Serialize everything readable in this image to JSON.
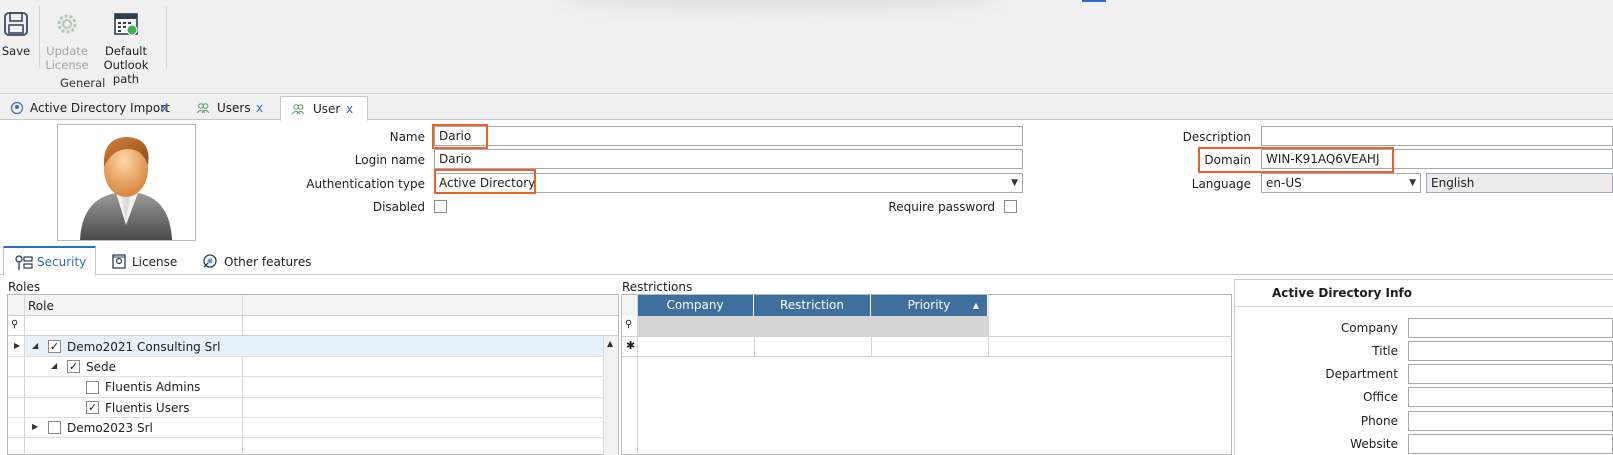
{
  "ribbon": {
    "buttons": [
      {
        "label": "Save",
        "icon": "save-icon",
        "enabled": true
      },
      {
        "label": "Update\nLicense",
        "line1": "Update",
        "line2": "License",
        "icon": "gear-icon",
        "enabled": false
      },
      {
        "label": "Default\nOutlook path",
        "line1": "Default",
        "line2": "Outlook path",
        "icon": "calendar-icon",
        "enabled": true
      }
    ],
    "group_label": "General"
  },
  "doc_tabs": [
    {
      "label": "Active Directory Import",
      "close": "x",
      "icon": "directory-icon"
    },
    {
      "label": "Users",
      "close": "x",
      "icon": "users-icon"
    },
    {
      "label": "User",
      "close": "x",
      "icon": "users-icon",
      "active": true
    }
  ],
  "form": {
    "name_label": "Name",
    "name_value": "Dario",
    "login_label": "Login name",
    "login_value": "Dario",
    "auth_label": "Authentication type",
    "auth_value": "Active Directory",
    "disabled_label": "Disabled",
    "disabled_checked": false,
    "require_password_label": "Require password",
    "require_password_checked": false,
    "description_label": "Description",
    "description_value": "",
    "domain_label": "Domain",
    "domain_value": "WIN-K91AQ6VEAHJ",
    "language_label": "Language",
    "language_value": "en-US",
    "language_name": "English"
  },
  "section_tabs": [
    {
      "label": "Security",
      "icon": "security-icon",
      "active": true
    },
    {
      "label": "License",
      "icon": "license-icon"
    },
    {
      "label": "Other features",
      "icon": "features-icon"
    }
  ],
  "roles": {
    "title": "Roles",
    "column": "Role",
    "rows": [
      {
        "label": "Demo2021 Consulting Srl",
        "checked": true,
        "level": 0,
        "expanded": true
      },
      {
        "label": "Sede",
        "checked": true,
        "level": 1,
        "expanded": true
      },
      {
        "label": "Fluentis Admins",
        "checked": false,
        "level": 2
      },
      {
        "label": "Fluentis Users",
        "checked": true,
        "level": 2
      },
      {
        "label": "Demo2023 Srl",
        "checked": false,
        "level": 0,
        "expanded": false
      }
    ]
  },
  "restrictions": {
    "title": "Restrictions",
    "columns": [
      "Company",
      "Restriction",
      "Priority"
    ]
  },
  "ad_info": {
    "title": "Active Directory Info",
    "fields": [
      "Company",
      "Title",
      "Department",
      "Office",
      "Phone",
      "Website"
    ]
  },
  "colors": {
    "accent": "#2a6ccb",
    "highlight": "#e8622a",
    "grid_header": "#3e6f9f"
  }
}
